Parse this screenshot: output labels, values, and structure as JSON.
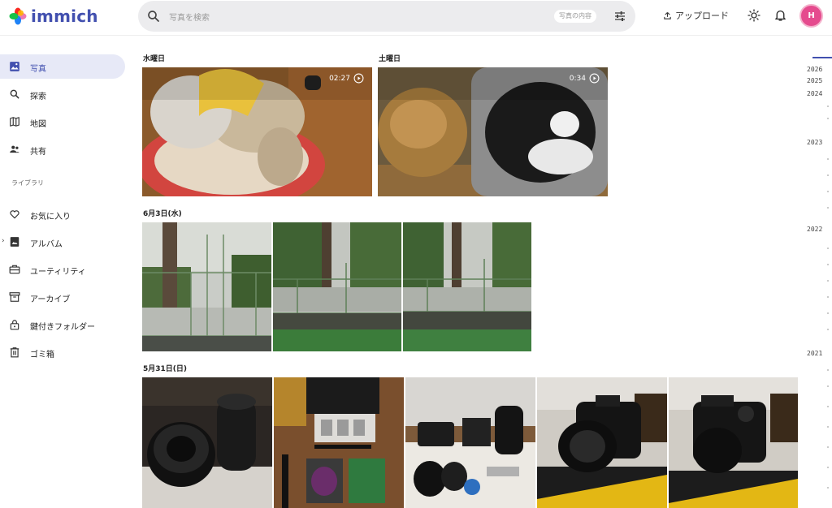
{
  "app": {
    "name": "immich"
  },
  "search": {
    "placeholder": "写真を検索",
    "chip": "写真の内容"
  },
  "header": {
    "upload_label": "アップロード",
    "avatar_initial": "H"
  },
  "sidebar": {
    "items": [
      {
        "label": "写真",
        "icon": "photos-icon",
        "active": true
      },
      {
        "label": "探索",
        "icon": "search-icon"
      },
      {
        "label": "地図",
        "icon": "map-icon"
      },
      {
        "label": "共有",
        "icon": "sharing-icon"
      }
    ],
    "library_heading": "ライブラリ",
    "library_items": [
      {
        "label": "お気に入り",
        "icon": "heart-icon"
      },
      {
        "label": "アルバム",
        "icon": "album-icon"
      },
      {
        "label": "ユーティリティ",
        "icon": "toolbox-icon"
      },
      {
        "label": "アーカイブ",
        "icon": "archive-icon"
      },
      {
        "label": "鍵付きフォルダー",
        "icon": "lock-icon"
      },
      {
        "label": "ゴミ箱",
        "icon": "trash-icon"
      }
    ]
  },
  "groups": [
    {
      "date": "水曜日",
      "videos": [
        {
          "duration": "02:27",
          "subject": "dog on cushion"
        }
      ]
    },
    {
      "date": "土曜日",
      "videos": [
        {
          "duration": "0:34",
          "subject": "cats in pet house"
        }
      ]
    },
    {
      "date": "6月3日(水)",
      "photos": [
        "fenced field",
        "fenced field",
        "fenced field"
      ]
    },
    {
      "date": "5月31日(日)",
      "photos": [
        "camera lenses",
        "filters and accessories",
        "camera kit",
        "Nikon camera",
        "Nikon camera"
      ]
    }
  ],
  "timeline": {
    "years": [
      "2026",
      "2025",
      "2024",
      "2023",
      "2022",
      "2021"
    ]
  }
}
